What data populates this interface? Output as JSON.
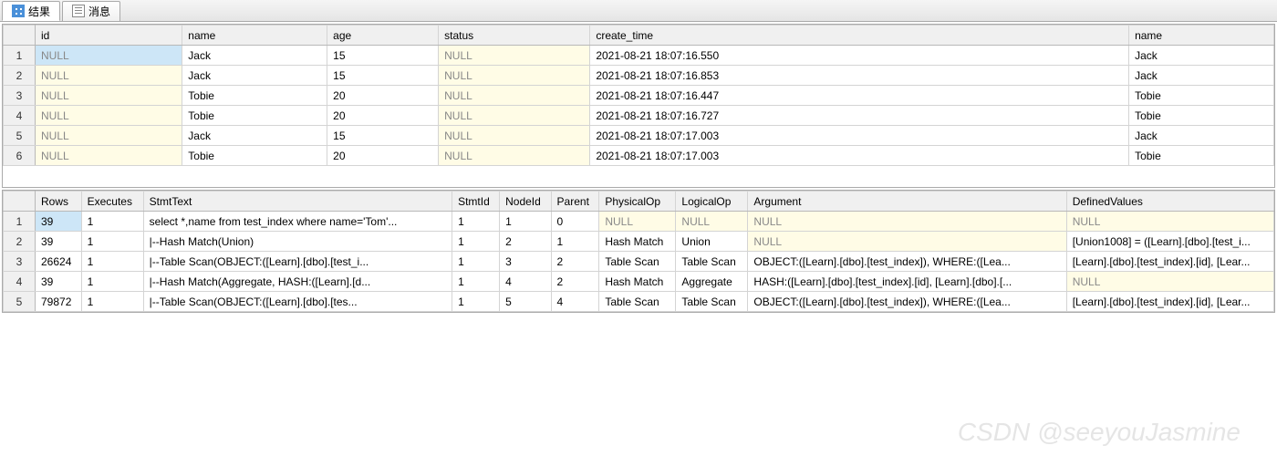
{
  "tabs": {
    "results": "结果",
    "messages": "消息"
  },
  "grid1": {
    "headers": [
      "id",
      "name",
      "age",
      "status",
      "create_time",
      "name"
    ],
    "rows": [
      [
        "NULL",
        "Jack",
        "15",
        "NULL",
        "2021-08-21 18:07:16.550",
        "Jack"
      ],
      [
        "NULL",
        "Jack",
        "15",
        "NULL",
        "2021-08-21 18:07:16.853",
        "Jack"
      ],
      [
        "NULL",
        "Tobie",
        "20",
        "NULL",
        "2021-08-21 18:07:16.447",
        "Tobie"
      ],
      [
        "NULL",
        "Tobie",
        "20",
        "NULL",
        "2021-08-21 18:07:16.727",
        "Tobie"
      ],
      [
        "NULL",
        "Jack",
        "15",
        "NULL",
        "2021-08-21 18:07:17.003",
        "Jack"
      ],
      [
        "NULL",
        "Tobie",
        "20",
        "NULL",
        "2021-08-21 18:07:17.003",
        "Tobie"
      ]
    ]
  },
  "grid2": {
    "headers": [
      "Rows",
      "Executes",
      "StmtText",
      "StmtId",
      "NodeId",
      "Parent",
      "PhysicalOp",
      "LogicalOp",
      "Argument",
      "DefinedValues"
    ],
    "rows": [
      [
        "39",
        "1",
        "select *,name from test_index where name='Tom'...",
        "1",
        "1",
        "0",
        "NULL",
        "NULL",
        "NULL",
        "NULL"
      ],
      [
        "39",
        "1",
        "  |--Hash Match(Union)",
        "1",
        "2",
        "1",
        "Hash Match",
        "Union",
        "NULL",
        "[Union1008] = ([Learn].[dbo].[test_i..."
      ],
      [
        "26624",
        "1",
        "       |--Table Scan(OBJECT:([Learn].[dbo].[test_i...",
        "1",
        "3",
        "2",
        "Table Scan",
        "Table Scan",
        "OBJECT:([Learn].[dbo].[test_index]), WHERE:([Lea...",
        "[Learn].[dbo].[test_index].[id], [Lear..."
      ],
      [
        "39",
        "1",
        "       |--Hash Match(Aggregate, HASH:([Learn].[d...",
        "1",
        "4",
        "2",
        "Hash Match",
        "Aggregate",
        "HASH:([Learn].[dbo].[test_index].[id], [Learn].[dbo].[...",
        "NULL"
      ],
      [
        "79872",
        "1",
        "            |--Table Scan(OBJECT:([Learn].[dbo].[tes...",
        "1",
        "5",
        "4",
        "Table Scan",
        "Table Scan",
        "OBJECT:([Learn].[dbo].[test_index]), WHERE:([Lea...",
        "[Learn].[dbo].[test_index].[id], [Lear..."
      ]
    ]
  },
  "watermark": "CSDN @seeyouJasmine"
}
